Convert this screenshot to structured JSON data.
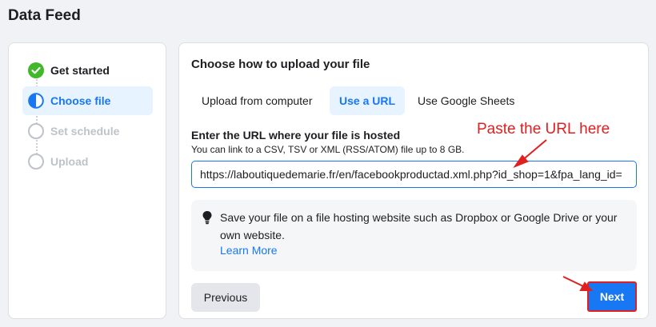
{
  "page": {
    "title": "Data Feed"
  },
  "stepper": {
    "steps": [
      {
        "label": "Get started",
        "state": "done",
        "icon": "check-circle-icon"
      },
      {
        "label": "Choose file",
        "state": "active",
        "icon": "half-circle-icon"
      },
      {
        "label": "Set schedule",
        "state": "todo",
        "icon": "empty-circle-icon"
      },
      {
        "label": "Upload",
        "state": "todo",
        "icon": "empty-circle-icon"
      }
    ]
  },
  "upload": {
    "title": "Choose how to upload your file",
    "tabs": [
      {
        "label": "Upload from computer",
        "selected": false
      },
      {
        "label": "Use a URL",
        "selected": true
      },
      {
        "label": "Use Google Sheets",
        "selected": false
      }
    ],
    "url_label": "Enter the URL where your file is hosted",
    "url_help": "You can link to a CSV, TSV or XML (RSS/ATOM) file up to 8 GB.",
    "url_value": "https://laboutiquedemarie.fr/en/facebookproductad.xml.php?id_shop=1&fpa_lang_id=",
    "tip_text": "Save your file on a file hosting website such as Dropbox or Google Drive or your own website.",
    "learn_more": "Learn More",
    "previous_label": "Previous",
    "next_label": "Next"
  },
  "annotations": {
    "paste_hint": "Paste the URL here",
    "color": "#e02020"
  },
  "colors": {
    "accent": "#1877f2",
    "success": "#42b72a",
    "annotation": "#e02020"
  }
}
